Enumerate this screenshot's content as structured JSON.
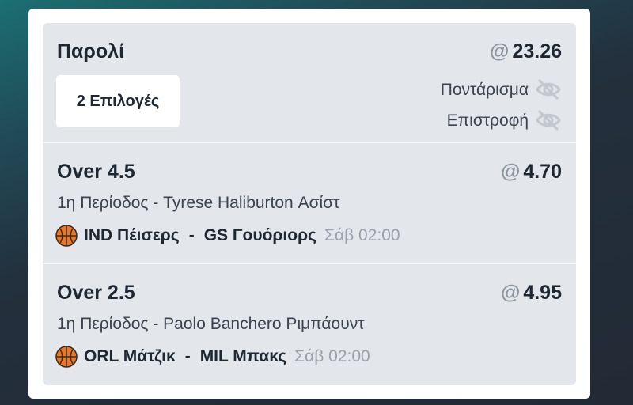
{
  "parlay": {
    "title": "Παρολί",
    "odds_at": "@",
    "odds": "23.26",
    "selections_label": "2 Επιλογές",
    "stake_label": "Ποντάρισμα",
    "return_label": "Επιστροφή"
  },
  "bets": [
    {
      "title": "Over 4.5",
      "odds_at": "@",
      "odds": "4.70",
      "description": "1η Περίοδος - Tyrese Haliburton Ασίστ",
      "home": "IND Πέισερς",
      "dash": "-",
      "away": "GS Γουόριορς",
      "time": "Σάβ 02:00"
    },
    {
      "title": "Over 2.5",
      "odds_at": "@",
      "odds": "4.95",
      "description": "1η Περίοδος - Paolo Banchero Ριμπάουντ",
      "home": "ORL Μάτζικ",
      "dash": "-",
      "away": "MIL Μπακς",
      "time": "Σάβ 02:00"
    }
  ],
  "icons": {
    "hidden": "eye-slash-icon",
    "sport": "basketball-icon"
  },
  "colors": {
    "panel": "#e3e6ea",
    "text": "#1f2733",
    "muted": "#9aa1aa",
    "basketball": "#e8782a"
  }
}
